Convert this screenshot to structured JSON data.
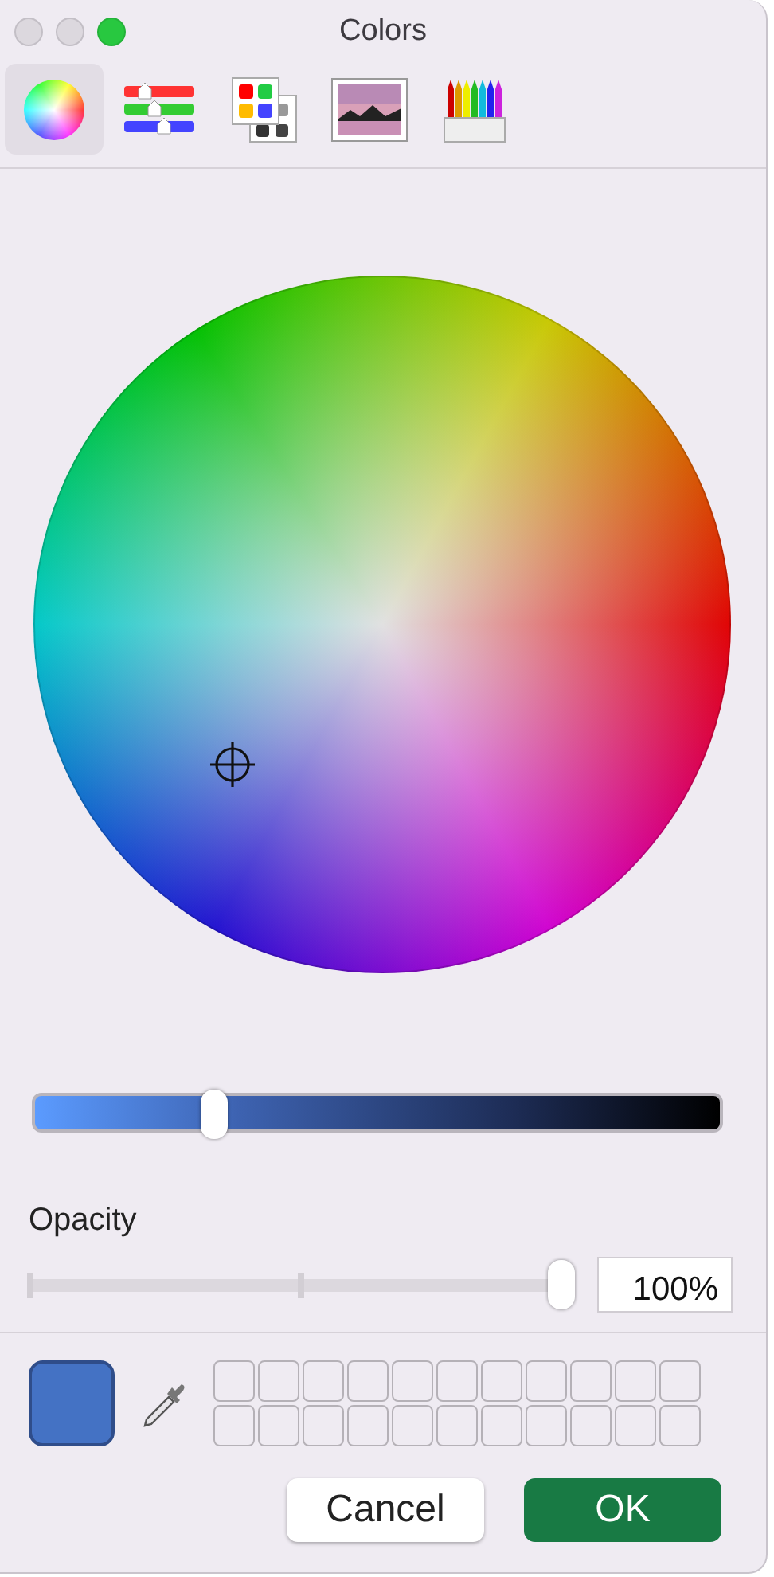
{
  "window": {
    "title": "Colors"
  },
  "traffic_lights": [
    {
      "kind": "close",
      "active": false
    },
    {
      "kind": "minimize",
      "active": false
    },
    {
      "kind": "zoom",
      "active": true
    }
  ],
  "modes": [
    {
      "kind": "wheel",
      "selected": true
    },
    {
      "kind": "sliders",
      "selected": false
    },
    {
      "kind": "palettes",
      "selected": false
    },
    {
      "kind": "image",
      "selected": false
    },
    {
      "kind": "pencils",
      "selected": false
    }
  ],
  "brightness": {
    "level": 0.26
  },
  "opacity": {
    "label": "Opacity",
    "level": 1.0,
    "value": "100%"
  },
  "current_color": {
    "color": "#4472c4"
  },
  "swatches": [
    {
      "filled": false
    },
    {
      "filled": false
    },
    {
      "filled": false
    },
    {
      "filled": false
    },
    {
      "filled": false
    },
    {
      "filled": false
    },
    {
      "filled": false
    },
    {
      "filled": false
    },
    {
      "filled": false
    },
    {
      "filled": false
    },
    {
      "filled": false
    },
    {
      "filled": false
    },
    {
      "filled": false
    },
    {
      "filled": false
    },
    {
      "filled": false
    },
    {
      "filled": false
    },
    {
      "filled": false
    },
    {
      "filled": false
    },
    {
      "filled": false
    },
    {
      "filled": false
    },
    {
      "filled": false
    },
    {
      "filled": false
    }
  ],
  "buttons": [
    {
      "label": "Cancel",
      "kind": "secondary"
    },
    {
      "label": "OK",
      "kind": "primary"
    }
  ]
}
